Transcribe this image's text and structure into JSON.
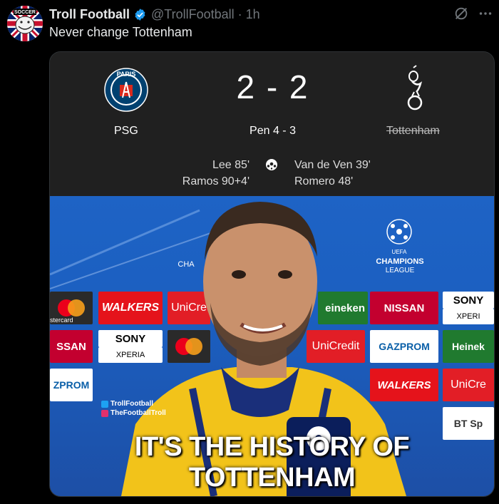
{
  "tweet": {
    "display_name": "Troll Football",
    "handle": "@TrollFootball",
    "separator": "·",
    "time": "1h",
    "text": "Never change Tottenham",
    "avatar_icon": "troll-face-logo",
    "verified_color": "#1d9bf0"
  },
  "match": {
    "home_team": "PSG",
    "away_team": "Tottenham",
    "score": "2 - 2",
    "penalties": "Pen  4 - 3",
    "home_scorers": [
      "Lee 85'",
      "Ramos 90+4'"
    ],
    "away_scorers": [
      "Van de Ven 39'",
      "Romero 48'"
    ],
    "psg_logo_text": "PARIS"
  },
  "photo": {
    "caption": "IT'S THE HISTORY OF TOTTENHAM",
    "social_twitter": "TrollFootball",
    "social_instagram": "TheFootballTroll",
    "cl_logo_text_1": "CHAMPIONS",
    "cl_logo_text_2": "LEAGUE",
    "cl_logo_top": "UEFA",
    "cl_partial": "CHA",
    "boards": {
      "walkers": "WALKERS",
      "unicredit_partial": "UniCre",
      "heineken_partial": "eineken",
      "nissan": "NISSAN",
      "sony_partial": "SONY",
      "xperia_partial": "XPERI",
      "mastercard_partial": "stercard",
      "nissan_partial": "SSAN",
      "sony": "SONY",
      "xperia": "XPERIA",
      "unicredit": "UniCredit",
      "gazprom": "GAZPROM",
      "heineken_partial2": "Heinek",
      "gazprom_partial": "ZPROM",
      "walkers2": "WALKERS",
      "unicredit_partial2": "UniCre",
      "bt_partial": "BT Sp"
    }
  }
}
